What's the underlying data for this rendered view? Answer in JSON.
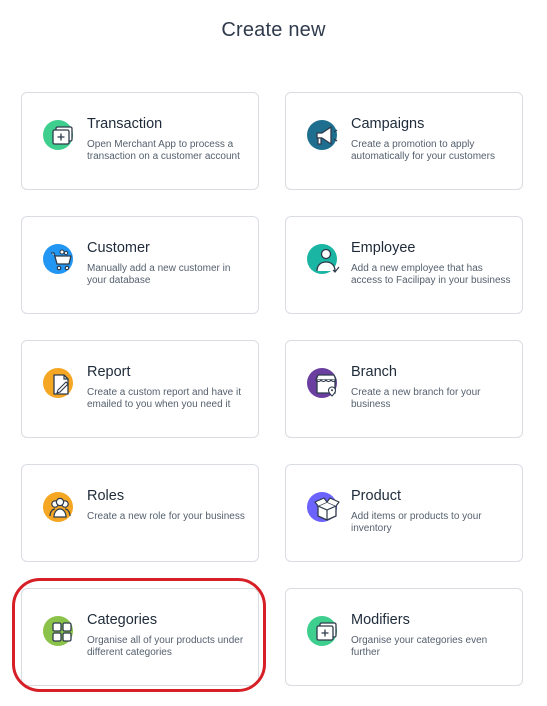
{
  "header": {
    "title": "Create new"
  },
  "cards": [
    {
      "title": "Transaction",
      "desc": "Open Merchant App to process a transaction on a customer account",
      "icon": "transaction-icon",
      "color": "#3ecf8e"
    },
    {
      "title": "Campaigns",
      "desc": "Create a promotion to apply automatically for your customers",
      "icon": "megaphone-icon",
      "color": "#1e6f8f"
    },
    {
      "title": "Customer",
      "desc": "Manually add a new customer in your database",
      "icon": "cart-icon",
      "color": "#2196f3"
    },
    {
      "title": "Employee",
      "desc": "Add a new employee that has access to Facilipay in your business",
      "icon": "employee-icon",
      "color": "#1bb5a3"
    },
    {
      "title": "Report",
      "desc": "Create a custom report and have it emailed to you when you need it",
      "icon": "report-icon",
      "color": "#f5a623"
    },
    {
      "title": "Branch",
      "desc": "Create a new branch for your business",
      "icon": "store-icon",
      "color": "#6a3fa0"
    },
    {
      "title": "Roles",
      "desc": "Create a new role for your business",
      "icon": "roles-icon",
      "color": "#f5a623"
    },
    {
      "title": "Product",
      "desc": "Add items or products to your inventory",
      "icon": "box-icon",
      "color": "#6c63ff"
    },
    {
      "title": "Categories",
      "desc": "Organise all of your products under different categories",
      "icon": "categories-icon",
      "color": "#8bc34a"
    },
    {
      "title": "Modifiers",
      "desc": "Organise your categories even further",
      "icon": "modifiers-icon",
      "color": "#3ecf8e"
    }
  ]
}
